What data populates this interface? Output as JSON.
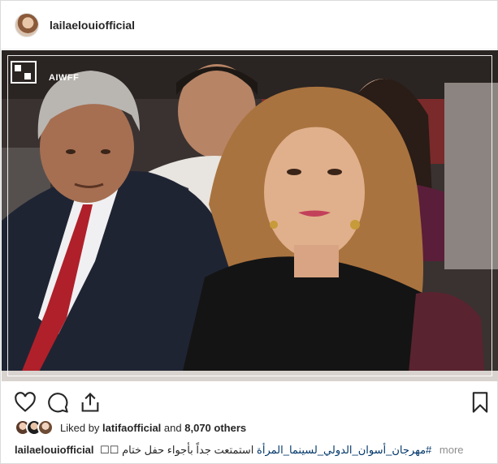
{
  "header": {
    "username": "lailaelouiofficial",
    "avatar_icon": "profile-avatar"
  },
  "photo": {
    "logo_text": "AIWFF",
    "colors": {
      "suit": "#1f2433",
      "dress": "#141414",
      "hair": "#a9733f",
      "bg_red": "#9a2a2a",
      "tie": "#b0202a"
    }
  },
  "actions": {
    "like_icon": "heart-icon",
    "comment_icon": "comment-icon",
    "share_icon": "share-icon",
    "save_icon": "bookmark-icon"
  },
  "likes": {
    "prefix": "Liked by",
    "user": "latifaofficial",
    "middle": "and",
    "count": "8,070 others"
  },
  "caption": {
    "username": "lailaelouiofficial",
    "text": "استمتعت جداً بأجواء حفل ختام",
    "hashtag": "#مهرجان_أسوان_الدولي_لسينما_المرأة",
    "emoji": "☐☐",
    "more": "more"
  }
}
